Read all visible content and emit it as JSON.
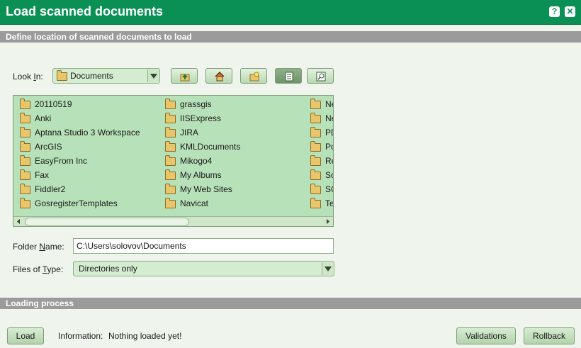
{
  "window": {
    "title": "Load scanned documents",
    "help_label": "?",
    "close_label": "✕"
  },
  "define_section": {
    "header": "Define location of scanned documents to load",
    "look_in_label_pre": "Look ",
    "look_in_label_key": "I",
    "look_in_label_post": "n:",
    "look_in_value": "Documents",
    "toolbar": [
      "up-folder-icon",
      "home-icon",
      "new-folder-icon",
      "list-view-icon",
      "details-view-icon"
    ],
    "columns": [
      [
        "20110519",
        "Anki",
        "Aptana Studio 3 Workspace",
        "ArcGIS",
        "EasyFrom Inc",
        "Fax",
        "Fiddler2",
        "GosregisterTemplates"
      ],
      [
        "grassgis",
        "IISExpress",
        "JIRA",
        "KMLDocuments",
        "Mikogo4",
        "My Albums",
        "My Web Sites",
        "Navicat"
      ],
      [
        "Ne",
        "Ne",
        "PD",
        "Po",
        "Re",
        "Sc",
        "SC",
        "Te"
      ]
    ],
    "folder_name_label_pre": "Folder ",
    "folder_name_label_key": "N",
    "folder_name_label_post": "ame:",
    "folder_name_value": "C:\\Users\\solovov\\Documents",
    "files_type_label_pre": "Files of ",
    "files_type_label_key": "T",
    "files_type_label_post": "ype:",
    "files_type_value": "Directories only"
  },
  "loading_section": {
    "header": "Loading process",
    "load_button": "Load",
    "info_label": "Information:",
    "info_value": "Nothing loaded yet!",
    "validations_button": "Validations",
    "rollback_button": "Rollback"
  },
  "colors": {
    "title_bar": "#0a9055",
    "section_header": "#9b9b9b",
    "list_background": "#b7e1b8",
    "page_background": "#eff5ec"
  }
}
